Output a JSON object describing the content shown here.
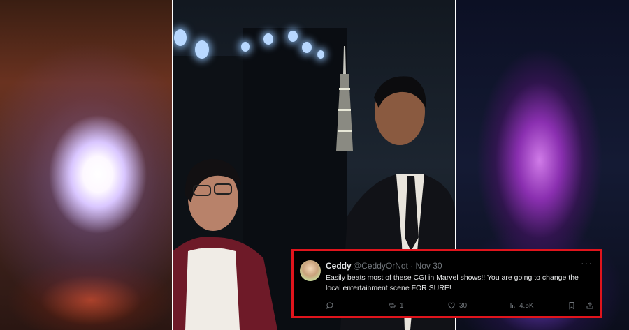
{
  "tweet": {
    "display_name": "Ceddy",
    "handle": "@CeddyOrNot",
    "date": "Nov 30",
    "handle_date": "@CeddyOrNot · Nov 30",
    "more_label": "···",
    "text": "Easily beats most of these CGI in Marvel shows!! You are going to change the local entertainment scene FOR SURE!",
    "actions": {
      "reply_count": "",
      "retweet_count": "1",
      "like_count": "30",
      "views_count": "4.5K"
    },
    "border_color": "#e0141c"
  },
  "icons": [
    "reply-icon",
    "retweet-icon",
    "like-icon",
    "views-icon",
    "bookmark-icon",
    "share-icon"
  ]
}
